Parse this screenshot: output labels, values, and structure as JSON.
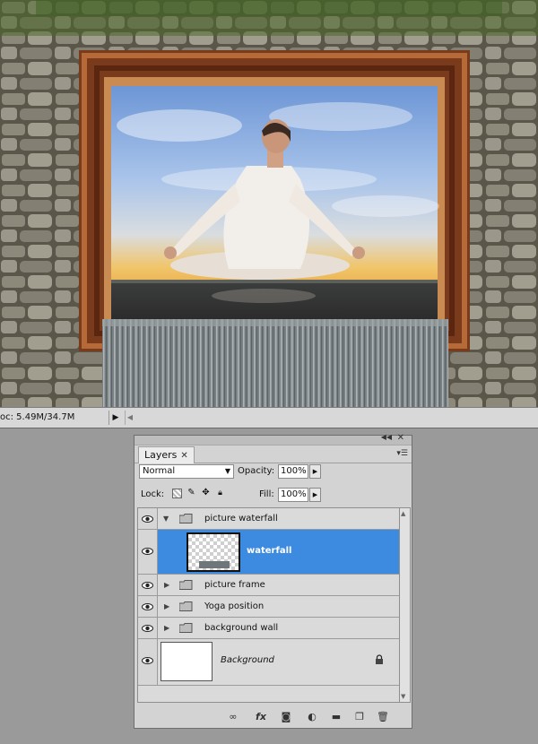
{
  "status_bar": {
    "doc_info": "oc: 5.49M/34.7M"
  },
  "layers_panel": {
    "tab_label": "Layers",
    "tab_close": "✕",
    "blend_mode": "Normal",
    "opacity_label": "Opacity:",
    "opacity_value": "100%",
    "lock_label": "Lock:",
    "fill_label": "Fill:",
    "fill_value": "100%",
    "layers": [
      {
        "name": "picture waterfall",
        "type": "group",
        "expanded": true,
        "visible": true
      },
      {
        "name": "waterfall",
        "type": "layer",
        "selected": true,
        "visible": true
      },
      {
        "name": "picture frame",
        "type": "group",
        "expanded": false,
        "visible": true
      },
      {
        "name": "Yoga position",
        "type": "group",
        "expanded": false,
        "visible": true
      },
      {
        "name": "background wall",
        "type": "group",
        "expanded": false,
        "visible": true
      },
      {
        "name": "Background",
        "type": "background",
        "locked": true,
        "visible": true
      }
    ],
    "footer_icons": [
      "link-layers-icon",
      "fx-icon",
      "add-mask-icon",
      "adjustment-layer-icon",
      "new-group-icon",
      "new-layer-icon",
      "trash-icon"
    ]
  },
  "colors": {
    "selection": "#3d8be0",
    "panel_bg": "#d3d3d3",
    "workspace": "#9a9a9a"
  }
}
